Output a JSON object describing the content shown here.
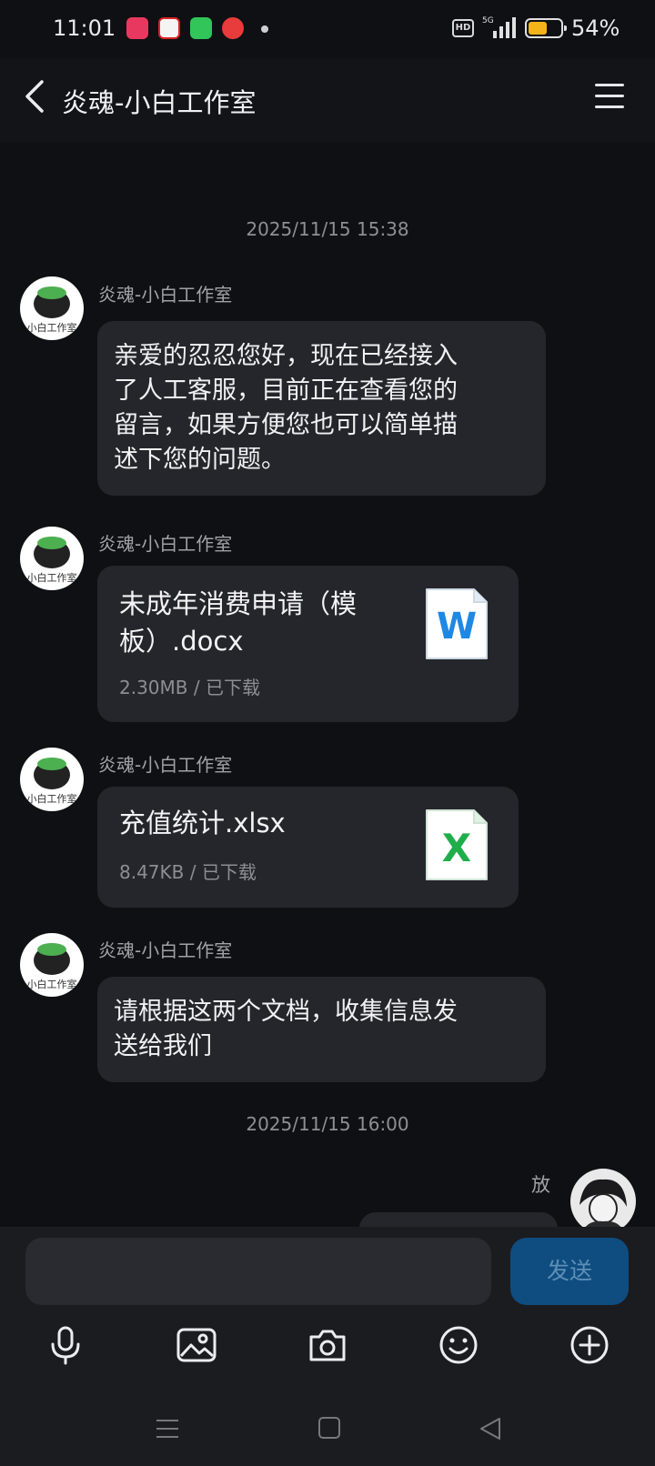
{
  "status_bar": {
    "time": "11:01",
    "hd": "HD",
    "network": "5G",
    "battery": "54%"
  },
  "header": {
    "title": "炎魂-小白工作室"
  },
  "messages": [
    {
      "timestamp": "2025/11/15 15:38"
    },
    {
      "sender": "炎魂-小白工作室",
      "text_lines": [
        "亲爱的忍忍您好，现在已经接入",
        "了人工客服，目前正在查看您的",
        "留言，如果方便您也可以简单描",
        "述下您的问题。"
      ]
    },
    {
      "sender": "炎魂-小白工作室",
      "file_name_lines": [
        "未成年消费申请（模",
        "板）.docx"
      ],
      "file_meta": "2.30MB / 已下载",
      "file_icon_letter": "W",
      "file_icon_color": "#1e88e5"
    },
    {
      "sender": "炎魂-小白工作室",
      "file_name_lines": [
        "充值统计.xlsx"
      ],
      "file_meta": "8.47KB / 已下载",
      "file_icon_letter": "X",
      "file_icon_color": "#1fae4b"
    },
    {
      "sender": "炎魂-小白工作室",
      "text_lines": [
        "请根据这两个文档，收集信息发",
        "送给我们"
      ]
    },
    {
      "timestamp": "2025/11/15 16:00"
    },
    {
      "sender": "放",
      "self": true
    }
  ],
  "composer": {
    "placeholder": "",
    "send_label": "发送"
  },
  "toolbar_icons": [
    "microphone-icon",
    "image-icon",
    "camera-icon",
    "emoji-icon",
    "plus-icon"
  ],
  "nav_icons": [
    "recents-icon",
    "home-icon",
    "back-icon"
  ],
  "colors": {
    "background": "#0f1013",
    "bubble": "#25262b",
    "send_button": "#0f4d80"
  }
}
